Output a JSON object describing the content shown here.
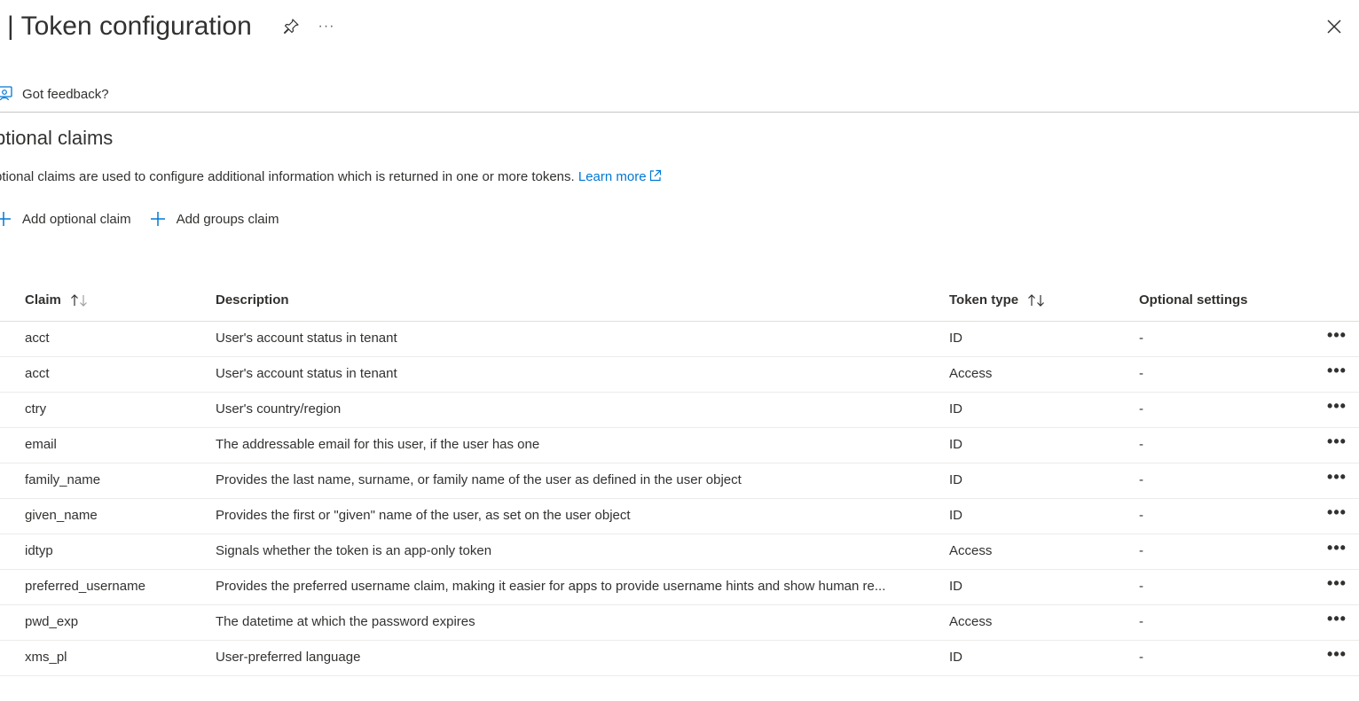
{
  "header": {
    "title": "| Token configuration",
    "more_label": "···"
  },
  "command_bar": {
    "feedback_label": "Got feedback?"
  },
  "section": {
    "title": "ptional claims",
    "description": "ptional claims are used to configure additional information which is returned in one or more tokens.",
    "learn_more_label": "Learn more"
  },
  "actions": {
    "add_optional_claim": "Add optional claim",
    "add_groups_claim": "Add groups claim"
  },
  "table": {
    "columns": {
      "claim": "Claim",
      "description": "Description",
      "token_type": "Token type",
      "optional_settings": "Optional settings"
    },
    "rows": [
      {
        "claim": "acct",
        "description": "User's account status in tenant",
        "token_type": "ID",
        "optional_settings": "-"
      },
      {
        "claim": "acct",
        "description": "User's account status in tenant",
        "token_type": "Access",
        "optional_settings": "-"
      },
      {
        "claim": "ctry",
        "description": "User's country/region",
        "token_type": "ID",
        "optional_settings": "-"
      },
      {
        "claim": "email",
        "description": "The addressable email for this user, if the user has one",
        "token_type": "ID",
        "optional_settings": "-"
      },
      {
        "claim": "family_name",
        "description": "Provides the last name, surname, or family name of the user as defined in the user object",
        "token_type": "ID",
        "optional_settings": "-"
      },
      {
        "claim": "given_name",
        "description": "Provides the first or \"given\" name of the user, as set on the user object",
        "token_type": "ID",
        "optional_settings": "-"
      },
      {
        "claim": "idtyp",
        "description": "Signals whether the token is an app-only token",
        "token_type": "Access",
        "optional_settings": "-"
      },
      {
        "claim": "preferred_username",
        "description": "Provides the preferred username claim, making it easier for apps to provide username hints and show human re...",
        "token_type": "ID",
        "optional_settings": "-"
      },
      {
        "claim": "pwd_exp",
        "description": "The datetime at which the password expires",
        "token_type": "Access",
        "optional_settings": "-"
      },
      {
        "claim": "xms_pl",
        "description": "User-preferred language",
        "token_type": "ID",
        "optional_settings": "-"
      }
    ],
    "row_more_label": "•••"
  },
  "colors": {
    "accent": "#0078d4",
    "text": "#323130",
    "divider": "#c8c6c4"
  },
  "icons": {
    "pin": "pin-icon",
    "more": "more-icon",
    "close": "close-icon",
    "feedback": "feedback-icon",
    "external_link": "external-link-icon",
    "add": "plus-icon",
    "sort": "sort-arrows-icon"
  }
}
